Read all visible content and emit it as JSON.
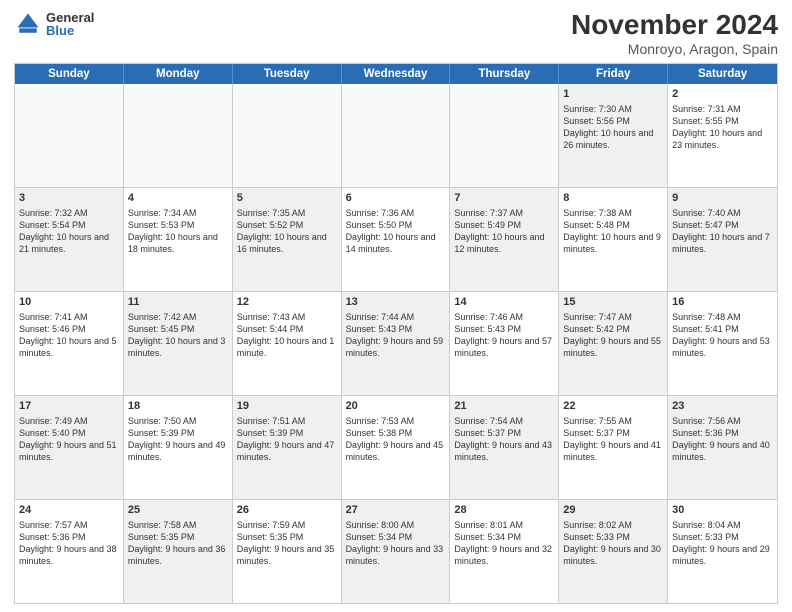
{
  "logo": {
    "general": "General",
    "blue": "Blue"
  },
  "title": "November 2024",
  "location": "Monroyo, Aragon, Spain",
  "calendar": {
    "headers": [
      "Sunday",
      "Monday",
      "Tuesday",
      "Wednesday",
      "Thursday",
      "Friday",
      "Saturday"
    ],
    "weeks": [
      [
        {
          "day": "",
          "info": "",
          "empty": true
        },
        {
          "day": "",
          "info": "",
          "empty": true
        },
        {
          "day": "",
          "info": "",
          "empty": true
        },
        {
          "day": "",
          "info": "",
          "empty": true
        },
        {
          "day": "",
          "info": "",
          "empty": true
        },
        {
          "day": "1",
          "info": "Sunrise: 7:30 AM\nSunset: 5:56 PM\nDaylight: 10 hours and 26 minutes.",
          "shaded": true
        },
        {
          "day": "2",
          "info": "Sunrise: 7:31 AM\nSunset: 5:55 PM\nDaylight: 10 hours and 23 minutes.",
          "shaded": false
        }
      ],
      [
        {
          "day": "3",
          "info": "Sunrise: 7:32 AM\nSunset: 5:54 PM\nDaylight: 10 hours and 21 minutes.",
          "shaded": true
        },
        {
          "day": "4",
          "info": "Sunrise: 7:34 AM\nSunset: 5:53 PM\nDaylight: 10 hours and 18 minutes.",
          "shaded": false
        },
        {
          "day": "5",
          "info": "Sunrise: 7:35 AM\nSunset: 5:52 PM\nDaylight: 10 hours and 16 minutes.",
          "shaded": true
        },
        {
          "day": "6",
          "info": "Sunrise: 7:36 AM\nSunset: 5:50 PM\nDaylight: 10 hours and 14 minutes.",
          "shaded": false
        },
        {
          "day": "7",
          "info": "Sunrise: 7:37 AM\nSunset: 5:49 PM\nDaylight: 10 hours and 12 minutes.",
          "shaded": true
        },
        {
          "day": "8",
          "info": "Sunrise: 7:38 AM\nSunset: 5:48 PM\nDaylight: 10 hours and 9 minutes.",
          "shaded": false
        },
        {
          "day": "9",
          "info": "Sunrise: 7:40 AM\nSunset: 5:47 PM\nDaylight: 10 hours and 7 minutes.",
          "shaded": true
        }
      ],
      [
        {
          "day": "10",
          "info": "Sunrise: 7:41 AM\nSunset: 5:46 PM\nDaylight: 10 hours and 5 minutes.",
          "shaded": false
        },
        {
          "day": "11",
          "info": "Sunrise: 7:42 AM\nSunset: 5:45 PM\nDaylight: 10 hours and 3 minutes.",
          "shaded": true
        },
        {
          "day": "12",
          "info": "Sunrise: 7:43 AM\nSunset: 5:44 PM\nDaylight: 10 hours and 1 minute.",
          "shaded": false
        },
        {
          "day": "13",
          "info": "Sunrise: 7:44 AM\nSunset: 5:43 PM\nDaylight: 9 hours and 59 minutes.",
          "shaded": true
        },
        {
          "day": "14",
          "info": "Sunrise: 7:46 AM\nSunset: 5:43 PM\nDaylight: 9 hours and 57 minutes.",
          "shaded": false
        },
        {
          "day": "15",
          "info": "Sunrise: 7:47 AM\nSunset: 5:42 PM\nDaylight: 9 hours and 55 minutes.",
          "shaded": true
        },
        {
          "day": "16",
          "info": "Sunrise: 7:48 AM\nSunset: 5:41 PM\nDaylight: 9 hours and 53 minutes.",
          "shaded": false
        }
      ],
      [
        {
          "day": "17",
          "info": "Sunrise: 7:49 AM\nSunset: 5:40 PM\nDaylight: 9 hours and 51 minutes.",
          "shaded": true
        },
        {
          "day": "18",
          "info": "Sunrise: 7:50 AM\nSunset: 5:39 PM\nDaylight: 9 hours and 49 minutes.",
          "shaded": false
        },
        {
          "day": "19",
          "info": "Sunrise: 7:51 AM\nSunset: 5:39 PM\nDaylight: 9 hours and 47 minutes.",
          "shaded": true
        },
        {
          "day": "20",
          "info": "Sunrise: 7:53 AM\nSunset: 5:38 PM\nDaylight: 9 hours and 45 minutes.",
          "shaded": false
        },
        {
          "day": "21",
          "info": "Sunrise: 7:54 AM\nSunset: 5:37 PM\nDaylight: 9 hours and 43 minutes.",
          "shaded": true
        },
        {
          "day": "22",
          "info": "Sunrise: 7:55 AM\nSunset: 5:37 PM\nDaylight: 9 hours and 41 minutes.",
          "shaded": false
        },
        {
          "day": "23",
          "info": "Sunrise: 7:56 AM\nSunset: 5:36 PM\nDaylight: 9 hours and 40 minutes.",
          "shaded": true
        }
      ],
      [
        {
          "day": "24",
          "info": "Sunrise: 7:57 AM\nSunset: 5:36 PM\nDaylight: 9 hours and 38 minutes.",
          "shaded": false
        },
        {
          "day": "25",
          "info": "Sunrise: 7:58 AM\nSunset: 5:35 PM\nDaylight: 9 hours and 36 minutes.",
          "shaded": true
        },
        {
          "day": "26",
          "info": "Sunrise: 7:59 AM\nSunset: 5:35 PM\nDaylight: 9 hours and 35 minutes.",
          "shaded": false
        },
        {
          "day": "27",
          "info": "Sunrise: 8:00 AM\nSunset: 5:34 PM\nDaylight: 9 hours and 33 minutes.",
          "shaded": true
        },
        {
          "day": "28",
          "info": "Sunrise: 8:01 AM\nSunset: 5:34 PM\nDaylight: 9 hours and 32 minutes.",
          "shaded": false
        },
        {
          "day": "29",
          "info": "Sunrise: 8:02 AM\nSunset: 5:33 PM\nDaylight: 9 hours and 30 minutes.",
          "shaded": true
        },
        {
          "day": "30",
          "info": "Sunrise: 8:04 AM\nSunset: 5:33 PM\nDaylight: 9 hours and 29 minutes.",
          "shaded": false
        }
      ]
    ]
  }
}
